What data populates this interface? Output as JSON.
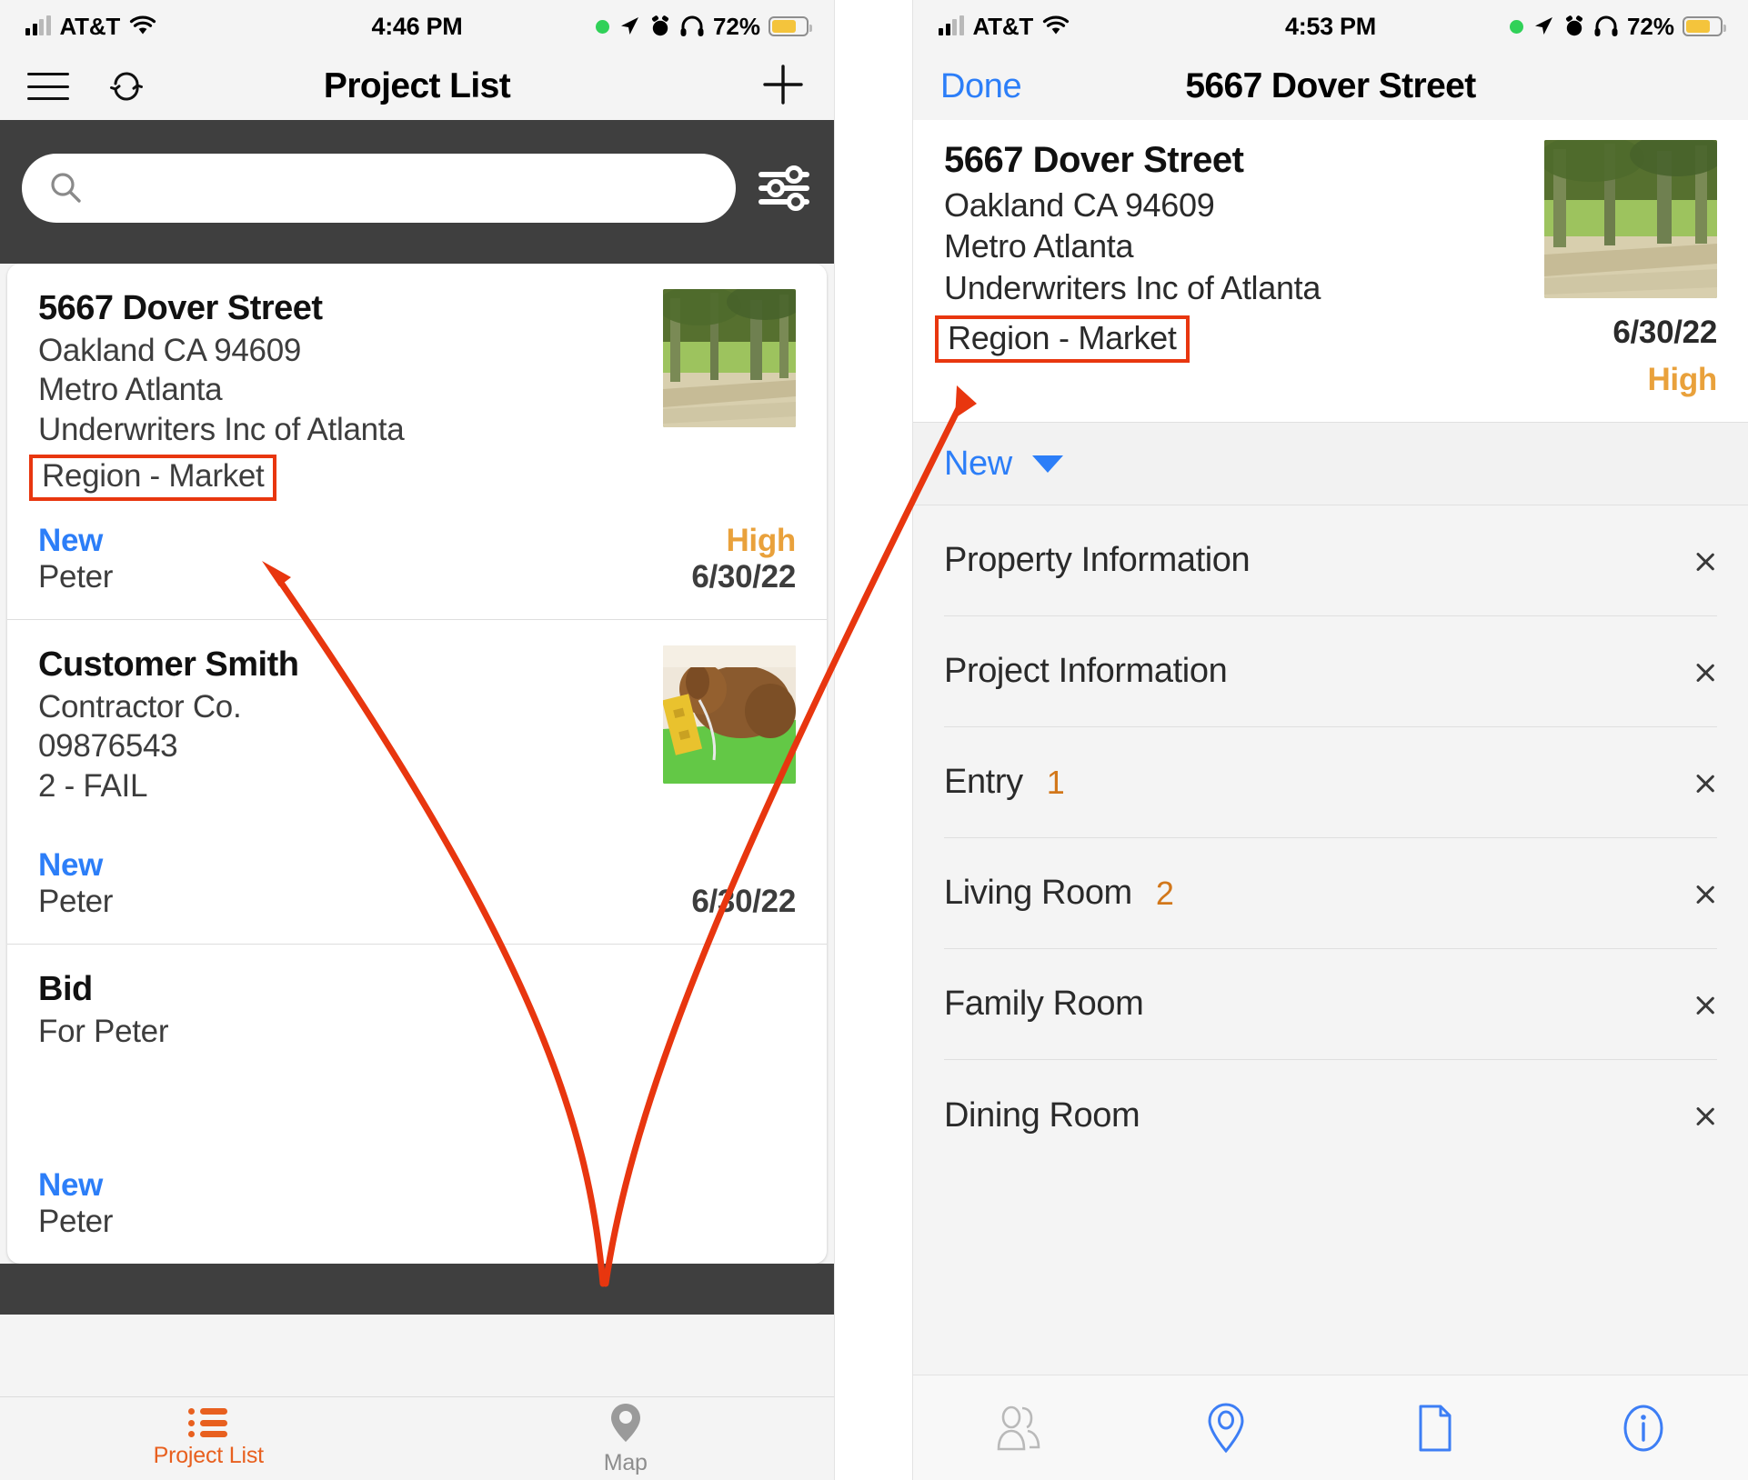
{
  "colors": {
    "accent_blue": "#2c7ef8",
    "accent_orange": "#e8601f",
    "priority_orange": "#e9a13b",
    "count_orange": "#d2771a",
    "annotation_red": "#e8360f",
    "dark_strip": "#3f3f3f"
  },
  "left_phone": {
    "status_bar": {
      "carrier": "AT&T",
      "time": "4:46 PM",
      "battery_pct": "72%"
    },
    "nav": {
      "title": "Project List",
      "menu_icon": "hamburger-icon",
      "refresh_icon": "sync-icon",
      "add_icon": "plus-icon"
    },
    "search": {
      "placeholder": "",
      "value": "",
      "search_icon": "search-icon",
      "filter_icon": "sliders-filter-icon"
    },
    "cards": [
      {
        "title": "5667 Dover Street",
        "lines": [
          "Oakland CA 94609",
          "Metro Atlanta",
          "Underwriters Inc of Atlanta"
        ],
        "region": "Region - Market",
        "region_highlighted": true,
        "status": "New",
        "owner": "Peter",
        "priority": "High",
        "date": "6/30/22",
        "thumb": "tree-path-photo"
      },
      {
        "title": "Customer Smith",
        "lines": [
          "Contractor Co.",
          "09876543",
          "2 - FAIL"
        ],
        "region": "",
        "region_highlighted": false,
        "status": "New",
        "owner": "Peter",
        "priority": "",
        "date": "6/30/22",
        "thumb": "dog-photo"
      },
      {
        "title": "Bid",
        "lines": [
          "For Peter"
        ],
        "region": "",
        "region_highlighted": false,
        "status": "New",
        "owner": "Peter",
        "priority": "",
        "date": "",
        "thumb": ""
      }
    ],
    "tabs": [
      {
        "label": "Project List",
        "icon": "list-icon",
        "active": true
      },
      {
        "label": "Map",
        "icon": "map-pin-icon",
        "active": false
      }
    ]
  },
  "right_phone": {
    "status_bar": {
      "carrier": "AT&T",
      "time": "4:53 PM",
      "battery_pct": "72%"
    },
    "nav": {
      "done_label": "Done",
      "title": "5667 Dover Street"
    },
    "detail": {
      "title": "5667 Dover Street",
      "lines": [
        "Oakland CA 94609",
        "Metro Atlanta",
        "Underwriters Inc of Atlanta"
      ],
      "region": "Region - Market",
      "date": "6/30/22",
      "priority": "High",
      "thumb": "tree-path-photo"
    },
    "status_selector": {
      "label": "New",
      "caret_icon": "caret-down-icon"
    },
    "rows": [
      {
        "label": "Property Information",
        "count": ""
      },
      {
        "label": "Project Information",
        "count": ""
      },
      {
        "label": "Entry",
        "count": "1"
      },
      {
        "label": "Living Room",
        "count": "2"
      },
      {
        "label": "Family Room",
        "count": ""
      },
      {
        "label": "Dining Room",
        "count": ""
      }
    ],
    "bottom_bar": [
      {
        "icon": "contacts-people-icon",
        "active": false
      },
      {
        "icon": "map-pin-icon",
        "active": true
      },
      {
        "icon": "document-page-icon",
        "active": true
      },
      {
        "icon": "info-circle-icon",
        "active": true
      }
    ]
  }
}
